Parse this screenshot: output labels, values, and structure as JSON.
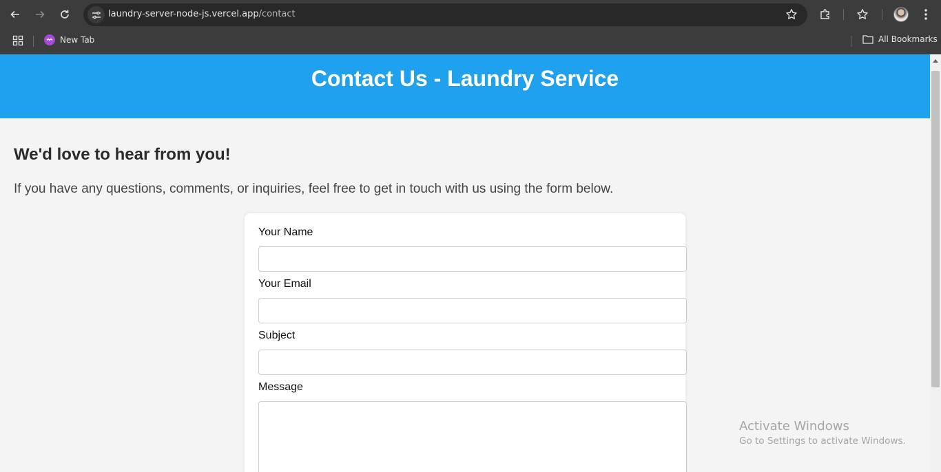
{
  "browser": {
    "url_host": "laundry-server-node-js.vercel.app",
    "url_path": "/contact",
    "bookmarks": [
      {
        "label": "New Tab"
      }
    ],
    "all_bookmarks_label": "All Bookmarks"
  },
  "page": {
    "header_title": "Contact Us - Laundry Service",
    "intro_heading": "We'd love to hear from you!",
    "intro_text": "If you have any questions, comments, or inquiries, feel free to get in touch with us using the form below.",
    "form": {
      "name_label": "Your Name",
      "name_value": "",
      "email_label": "Your Email",
      "email_value": "",
      "subject_label": "Subject",
      "subject_value": "",
      "message_label": "Message",
      "message_value": ""
    }
  },
  "watermark": {
    "line1": "Activate Windows",
    "line2": "Go to Settings to activate Windows."
  },
  "colors": {
    "header_bg": "#20a1ee",
    "page_bg": "#f4f4f4",
    "chrome_bg": "#3c3c3c"
  }
}
